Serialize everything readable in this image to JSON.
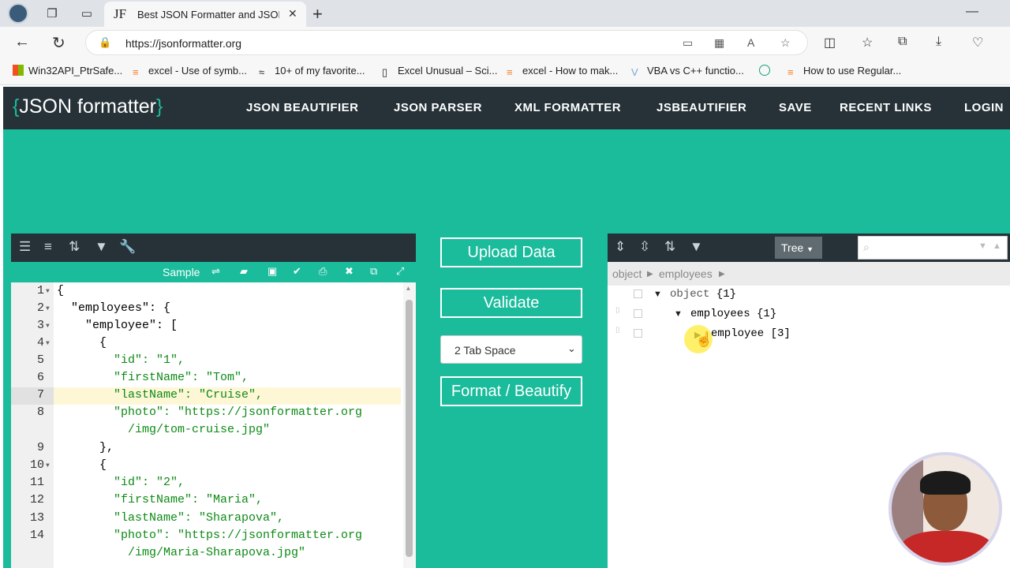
{
  "browser": {
    "tab_favicon": "JF",
    "tab_title": "Best JSON Formatter and JSON V",
    "url": "https://jsonformatter.org",
    "bookmarks": [
      "Win32API_PtrSafe...",
      "excel - Use of symb...",
      "10+ of my favorite...",
      "Excel Unusual – Sci...",
      "excel - How to mak...",
      "VBA vs C++ functio...",
      "How to use Regular..."
    ]
  },
  "site": {
    "logo_open": "{",
    "logo_text": "JSON formatter",
    "logo_close": "}",
    "nav": [
      "JSON BEAUTIFIER",
      "JSON PARSER",
      "XML FORMATTER",
      "JSBEAUTIFIER",
      "SAVE",
      "RECENT LINKS",
      "LOGIN"
    ]
  },
  "editor": {
    "sample_label": "Sample",
    "line_numbers": [
      "1",
      "2",
      "3",
      "4",
      "5",
      "6",
      "7",
      "8",
      "9",
      "10",
      "11",
      "12",
      "13",
      "14"
    ],
    "lines": [
      "{",
      "  \"employees\": {",
      "    \"employee\": [",
      "      {",
      "        \"id\": \"1\",",
      "        \"firstName\": \"Tom\",",
      "        \"lastName\": \"Cruise\",",
      "        \"photo\": \"https://jsonformatter.org",
      "          /img/tom-cruise.jpg\"",
      "      },",
      "      {",
      "        \"id\": \"2\",",
      "        \"firstName\": \"Maria\",",
      "        \"lastName\": \"Sharapova\",",
      "        \"photo\": \"https://jsonformatter.org",
      "          /img/Maria-Sharapova.jpg\""
    ]
  },
  "actions": {
    "upload": "Upload Data",
    "validate": "Validate",
    "indent_selected": "2 Tab Space",
    "format": "Format / Beautify"
  },
  "viewer": {
    "mode": "Tree",
    "breadcrumb": [
      "object",
      "employees"
    ],
    "nodes": [
      {
        "label": "object",
        "count": "{1}"
      },
      {
        "label": "employees",
        "count": "{1}"
      },
      {
        "label": "employee",
        "count": "[3]"
      }
    ]
  }
}
